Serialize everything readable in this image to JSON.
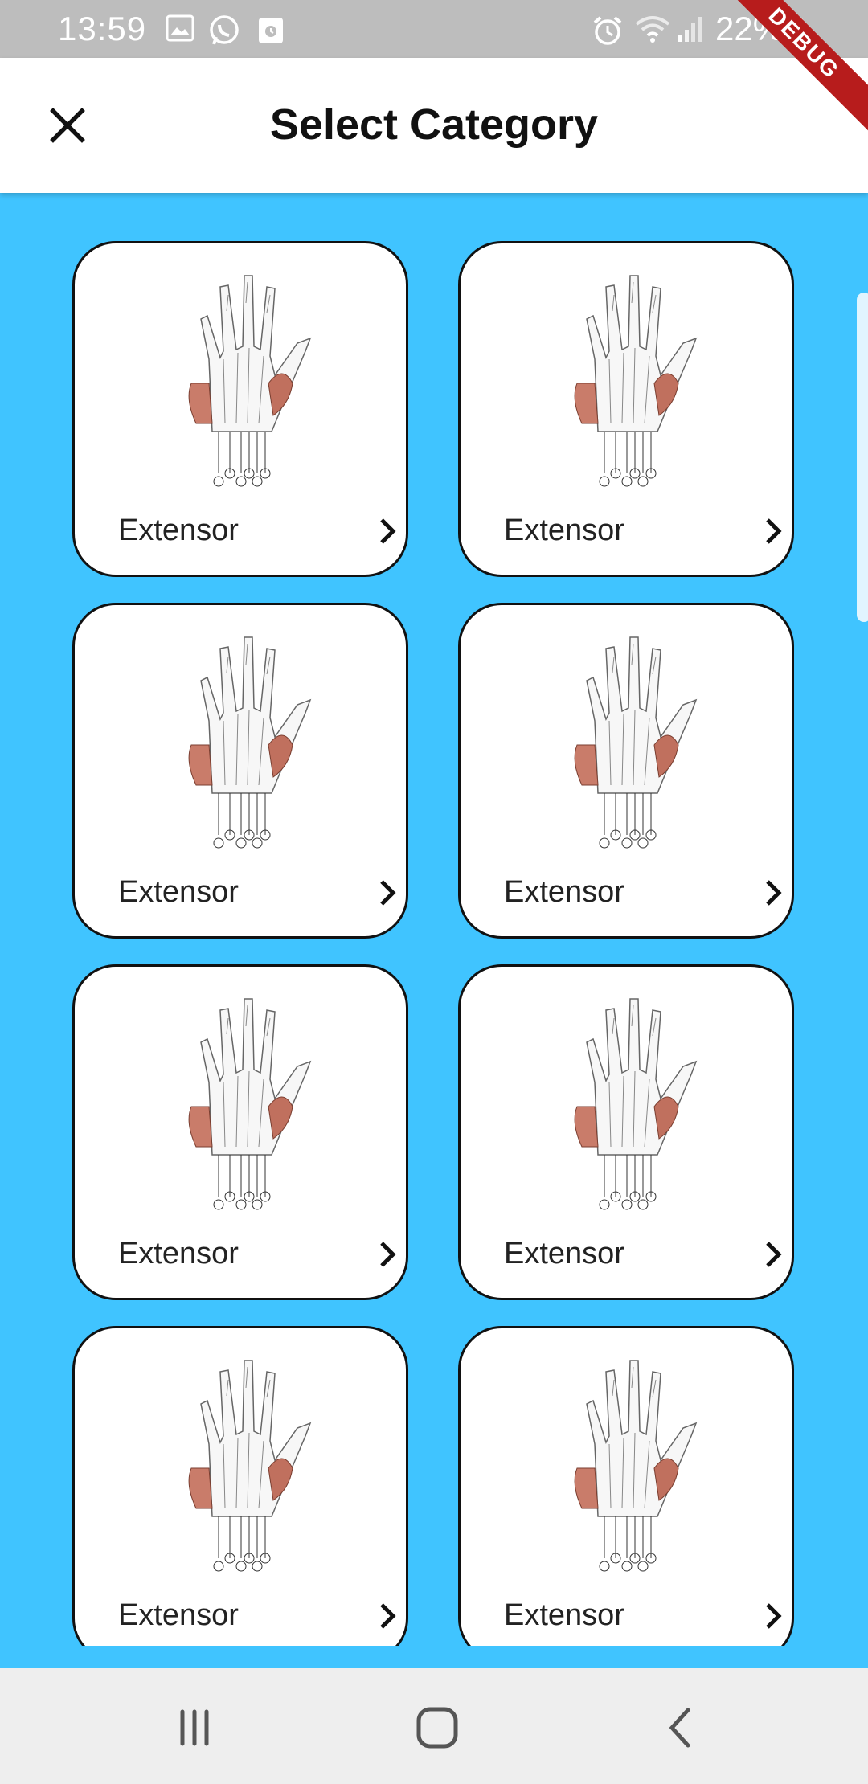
{
  "status_bar": {
    "time": "13:59",
    "battery": "22%",
    "icons": [
      "image-icon",
      "whatsapp-icon",
      "calendar-icon",
      "alarm-icon",
      "wifi-icon",
      "signal-icon"
    ]
  },
  "debug_banner": "DEBUG",
  "app_bar": {
    "title": "Select Category",
    "close_icon": "close-icon"
  },
  "categories": [
    {
      "label": "Extensor",
      "image": "hand-anatomy-image",
      "icon": "chevron-right-icon"
    },
    {
      "label": "Extensor",
      "image": "hand-anatomy-image",
      "icon": "chevron-right-icon"
    },
    {
      "label": "Extensor",
      "image": "hand-anatomy-image",
      "icon": "chevron-right-icon"
    },
    {
      "label": "Extensor",
      "image": "hand-anatomy-image",
      "icon": "chevron-right-icon"
    },
    {
      "label": "Extensor",
      "image": "hand-anatomy-image",
      "icon": "chevron-right-icon"
    },
    {
      "label": "Extensor",
      "image": "hand-anatomy-image",
      "icon": "chevron-right-icon"
    },
    {
      "label": "Extensor",
      "image": "hand-anatomy-image",
      "icon": "chevron-right-icon"
    },
    {
      "label": "Extensor",
      "image": "hand-anatomy-image",
      "icon": "chevron-right-icon"
    }
  ],
  "nav_bar": {
    "buttons": [
      "recents-icon",
      "home-icon",
      "back-icon"
    ]
  },
  "colors": {
    "background": "#40C4FF",
    "app_bar": "#FFFFFF",
    "card_border": "#111111",
    "status_bar": "#BDBDBD",
    "debug_banner": "#B71C1C"
  }
}
